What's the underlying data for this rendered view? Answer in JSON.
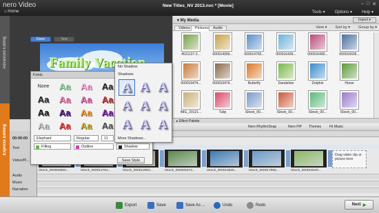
{
  "app": {
    "logo": "nero",
    "logo_sub": "Video",
    "title": "New Titles_NV 2013.nvc * [Movie]",
    "home": "Home"
  },
  "menu": {
    "tools": "Tools ▾",
    "options": "Options ▾",
    "help": "Help ▾"
  },
  "left_tabs": {
    "advanced": "Advanced Editing",
    "express": "Express Editing"
  },
  "preview": {
    "done_label": "Done",
    "text_label": "Text",
    "banner_text": "Family Vacation"
  },
  "media": {
    "header": "▾ My Media",
    "import_label": "Import ▾",
    "tabs": [
      {
        "label": "Videos"
      },
      {
        "label": "Pictures"
      },
      {
        "label": "Audio"
      }
    ],
    "tools": {
      "view": "View ▾",
      "sort": "Sort by ▾",
      "group": "Group by ▾"
    },
    "items": [
      {
        "label": "4521137-2...",
        "color": "#7aa14a"
      },
      {
        "label": "000014059...",
        "color": "#c7a24a"
      },
      {
        "label": "000014765...",
        "color": "#5a8fc9"
      },
      {
        "label": "000016439...",
        "color": "#6fb1d9"
      },
      {
        "label": "000016490...",
        "color": "#b84a7a"
      },
      {
        "label": "000016605...",
        "color": "#4a6fa0"
      },
      {
        "label": "000019474...",
        "color": "#c97a3a"
      },
      {
        "label": "000019474...",
        "color": "#8a6a4a"
      },
      {
        "label": "Butterfly",
        "color": "#d97a2a"
      },
      {
        "label": "Dandelion",
        "color": "#7ab84a"
      },
      {
        "label": "Dolphin",
        "color": "#3a8ac9"
      },
      {
        "label": "Horse",
        "color": "#5a9a3a"
      },
      {
        "label": "IMG_20121...",
        "color": "#c9b07a"
      },
      {
        "label": "Tulip",
        "color": "#d94a6a"
      },
      {
        "label": "iStock_00...",
        "color": "#7a9ac9"
      },
      {
        "label": "iStock_00...",
        "color": "#c95a3a"
      },
      {
        "label": "iStock_00...",
        "color": "#5ab87a"
      },
      {
        "label": "iStock_00...",
        "color": "#9a7ac9"
      },
      {
        "label": "iStock_00...",
        "color": "#3ab8b8"
      },
      {
        "label": "iStock_00...",
        "color": "#c9a03a"
      },
      {
        "label": "iStock_00...",
        "color": "#6a6a9a"
      }
    ]
  },
  "effect_palette": "▸ Effect Palette",
  "toolbar": {
    "rhythm": "Nero RhythmSnap",
    "pip": "Nero PiP",
    "themes": "Themes",
    "fit": "Fit Music"
  },
  "timeline": {
    "time": "00:00:00",
    "tracks": {
      "text": "Text",
      "video": "Video/Pi...",
      "audio": "Audio",
      "music": "Music",
      "narration": "Narration"
    },
    "clips": [
      {
        "label": "iStock_000008959...",
        "color": "#7a9a6a"
      },
      {
        "label": "iStock_000012754...",
        "color": "#4a6a8a"
      },
      {
        "label": "iStock_000012002...",
        "color": "#b8a06a"
      },
      {
        "label": "iStock_000009473...",
        "color": "#5a8a4a"
      },
      {
        "label": "iStock_000019625...",
        "color": "#3a7ab8"
      },
      {
        "label": "iStock_000017956...",
        "color": "#6a9ac9"
      },
      {
        "label": "iStock_000018420...",
        "color": "#8ab86a"
      }
    ],
    "drop_hint": "Drag video clip or picture here"
  },
  "fonts_panel": {
    "title": "Fonts",
    "none_label": "None",
    "style_glyph": "Aa",
    "font_name": "Elephant",
    "font_style": "Regular",
    "font_size": "11",
    "fill": "Filling",
    "outline": "Outline",
    "shadow": "Shadow",
    "save_style": "Save Style"
  },
  "shadow_panel": {
    "no_shadow": "No Shadow",
    "shadows": "Shadows",
    "glyph": "A",
    "more": "More Shadows..."
  },
  "bottom": {
    "export": "Export",
    "save": "Save",
    "save_as": "Save As ...",
    "undo": "Undo",
    "redo": "Redo",
    "next": "Next"
  }
}
